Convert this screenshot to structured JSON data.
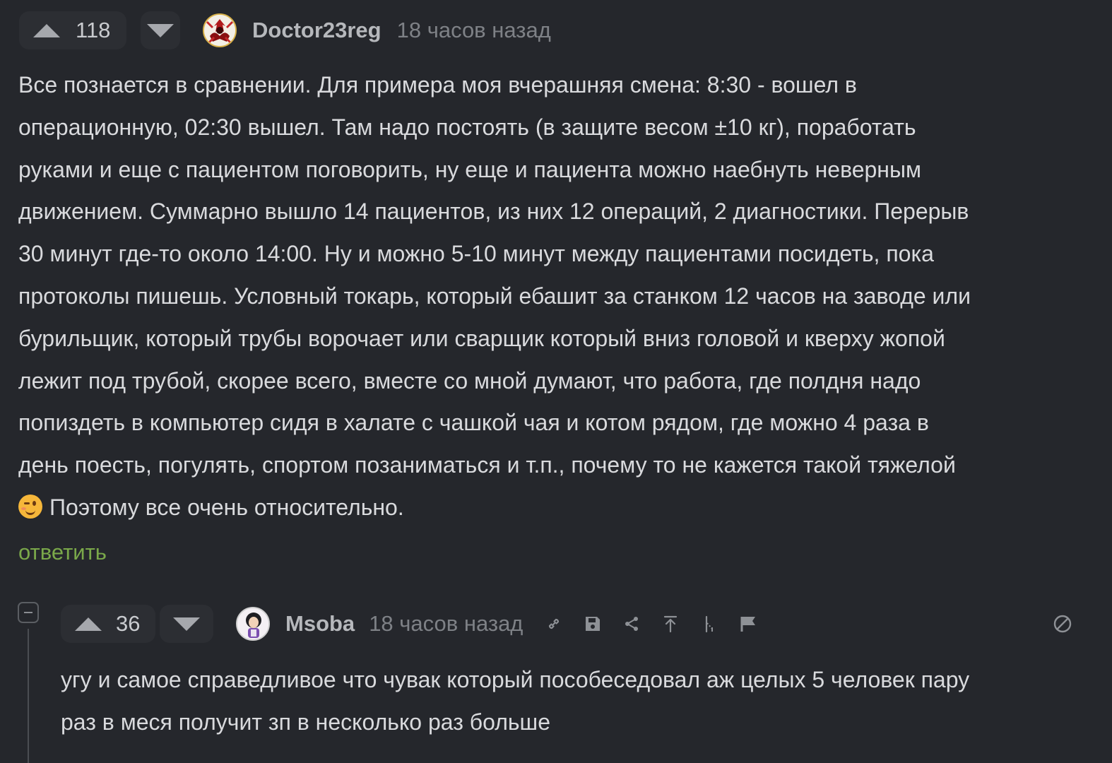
{
  "comment1": {
    "score": "118",
    "username": "Doctor23reg",
    "timestamp": "18 часов назад",
    "text_lines": [
      "Все познается в сравнении. Для примера моя вчерашняя смена: 8:30 - вошел в",
      "операционную, 02:30 вышел. Там надо постоять (в защите весом ±10 кг), поработать",
      "руками и еще с пациентом поговорить, ну еще и пациента можно наебнуть неверным",
      "движением. Суммарно вышло 14 пациентов, из них 12 операций, 2 диагностики. Перерыв",
      "30 минут где-то около 14:00. Ну и можно 5-10 минут между пациентами посидеть, пока",
      "протоколы пишешь. Условный токарь, который ебашит за станком 12 часов на заводе или",
      "бурильщик, который трубы ворочает или сварщик который вниз головой и кверху жопой",
      "лежит под трубой, скорее всего, вместе со мной думают, что работа, где полдня надо",
      "попиздеть в компьютер сидя в халате с чашкой чая и котом рядом, где можно 4 раза в",
      "день поесть, погулять, спортом позаниматься и т.п., почему то не кажется такой тяжелой"
    ],
    "last_line": "Поэтому все очень относительно.",
    "emoji": "winking-face",
    "reply_label": "ответить"
  },
  "comment2": {
    "score": "36",
    "username": "Msoba",
    "timestamp": "18 часов назад",
    "tools": [
      "link-icon",
      "save-icon",
      "share-icon",
      "scroll-to-parent-icon",
      "branch-icon",
      "report-flag-icon"
    ],
    "hide_icon": "hide-icon",
    "text_lines": [
      "угу и самое справедливое что чувак который пособеседовал аж целых 5 человек пару",
      "раз в меся получит зп в несколько раз больше"
    ]
  },
  "colors": {
    "background": "#25272c",
    "text": "#d9dadd",
    "reply": "#7aa84a",
    "muted": "#7e8186",
    "vote_box": "#2c2e33"
  }
}
